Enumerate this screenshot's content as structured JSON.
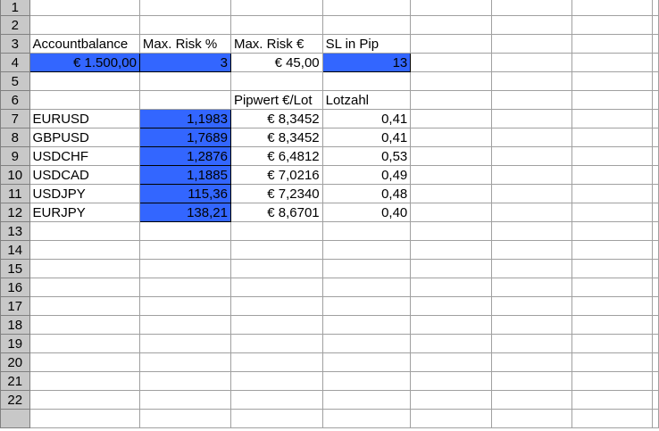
{
  "rows": [
    {
      "n": "1",
      "cells": [
        "",
        "",
        "",
        "",
        "",
        "",
        ""
      ]
    },
    {
      "n": "2",
      "cells": [
        "",
        "",
        "",
        "",
        "",
        "",
        ""
      ]
    },
    {
      "n": "3",
      "cells": [
        "Accountbalance",
        "Max. Risk %",
        "Max. Risk €",
        "SL in Pip",
        "",
        "",
        ""
      ]
    },
    {
      "n": "4",
      "cells": [
        "€ 1.500,00",
        "3",
        "€ 45,00",
        "13",
        "",
        "",
        ""
      ]
    },
    {
      "n": "5",
      "cells": [
        "",
        "",
        "",
        "",
        "",
        "",
        ""
      ]
    },
    {
      "n": "6",
      "cells": [
        "",
        "",
        "Pipwert €/Lot",
        "Lotzahl",
        "",
        "",
        ""
      ]
    },
    {
      "n": "7",
      "cells": [
        "EURUSD",
        "1,1983",
        "€ 8,3452",
        "0,41",
        "",
        "",
        ""
      ]
    },
    {
      "n": "8",
      "cells": [
        "GBPUSD",
        "1,7689",
        "€ 8,3452",
        "0,41",
        "",
        "",
        ""
      ]
    },
    {
      "n": "9",
      "cells": [
        "USDCHF",
        "1,2876",
        "€ 6,4812",
        "0,53",
        "",
        "",
        ""
      ]
    },
    {
      "n": "10",
      "cells": [
        "USDCAD",
        "1,1885",
        "€ 7,0216",
        "0,49",
        "",
        "",
        ""
      ]
    },
    {
      "n": "11",
      "cells": [
        "USDJPY",
        "115,36",
        "€ 7,2340",
        "0,48",
        "",
        "",
        ""
      ]
    },
    {
      "n": "12",
      "cells": [
        "EURJPY",
        "138,21",
        "€ 8,6701",
        "0,40",
        "",
        "",
        ""
      ]
    },
    {
      "n": "13",
      "cells": [
        "",
        "",
        "",
        "",
        "",
        "",
        ""
      ]
    },
    {
      "n": "14",
      "cells": [
        "",
        "",
        "",
        "",
        "",
        "",
        ""
      ]
    },
    {
      "n": "15",
      "cells": [
        "",
        "",
        "",
        "",
        "",
        "",
        ""
      ]
    },
    {
      "n": "16",
      "cells": [
        "",
        "",
        "",
        "",
        "",
        "",
        ""
      ]
    },
    {
      "n": "17",
      "cells": [
        "",
        "",
        "",
        "",
        "",
        "",
        ""
      ]
    },
    {
      "n": "18",
      "cells": [
        "",
        "",
        "",
        "",
        "",
        "",
        ""
      ]
    },
    {
      "n": "19",
      "cells": [
        "",
        "",
        "",
        "",
        "",
        "",
        ""
      ]
    },
    {
      "n": "20",
      "cells": [
        "",
        "",
        "",
        "",
        "",
        "",
        ""
      ]
    },
    {
      "n": "21",
      "cells": [
        "",
        "",
        "",
        "",
        "",
        "",
        ""
      ]
    },
    {
      "n": "22",
      "cells": [
        "",
        "",
        "",
        "",
        "",
        "",
        ""
      ]
    },
    {
      "n": "",
      "cells": [
        "",
        "",
        "",
        "",
        "",
        "",
        ""
      ]
    }
  ],
  "colors": {
    "highlight": "#3366ff"
  }
}
